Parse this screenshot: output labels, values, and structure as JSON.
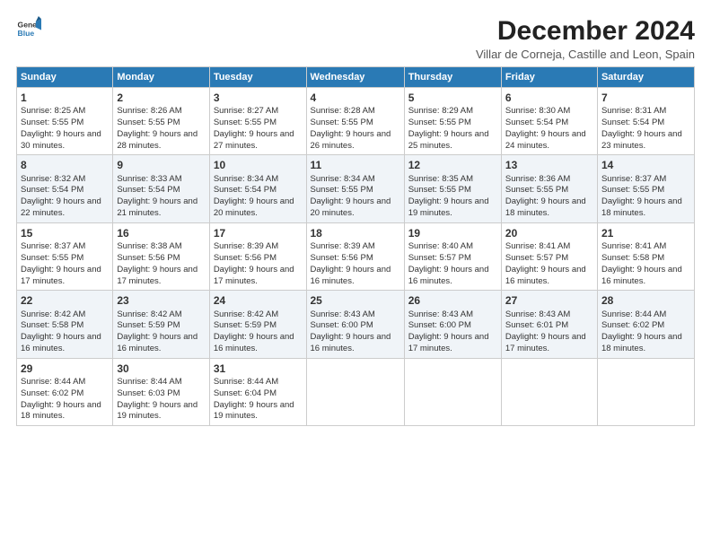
{
  "logo": {
    "line1": "General",
    "line2": "Blue"
  },
  "title": "December 2024",
  "subtitle": "Villar de Corneja, Castille and Leon, Spain",
  "headers": [
    "Sunday",
    "Monday",
    "Tuesday",
    "Wednesday",
    "Thursday",
    "Friday",
    "Saturday"
  ],
  "weeks": [
    [
      {
        "day": "1",
        "text": "Sunrise: 8:25 AM\nSunset: 5:55 PM\nDaylight: 9 hours and 30 minutes."
      },
      {
        "day": "2",
        "text": "Sunrise: 8:26 AM\nSunset: 5:55 PM\nDaylight: 9 hours and 28 minutes."
      },
      {
        "day": "3",
        "text": "Sunrise: 8:27 AM\nSunset: 5:55 PM\nDaylight: 9 hours and 27 minutes."
      },
      {
        "day": "4",
        "text": "Sunrise: 8:28 AM\nSunset: 5:55 PM\nDaylight: 9 hours and 26 minutes."
      },
      {
        "day": "5",
        "text": "Sunrise: 8:29 AM\nSunset: 5:55 PM\nDaylight: 9 hours and 25 minutes."
      },
      {
        "day": "6",
        "text": "Sunrise: 8:30 AM\nSunset: 5:54 PM\nDaylight: 9 hours and 24 minutes."
      },
      {
        "day": "7",
        "text": "Sunrise: 8:31 AM\nSunset: 5:54 PM\nDaylight: 9 hours and 23 minutes."
      }
    ],
    [
      {
        "day": "8",
        "text": "Sunrise: 8:32 AM\nSunset: 5:54 PM\nDaylight: 9 hours and 22 minutes."
      },
      {
        "day": "9",
        "text": "Sunrise: 8:33 AM\nSunset: 5:54 PM\nDaylight: 9 hours and 21 minutes."
      },
      {
        "day": "10",
        "text": "Sunrise: 8:34 AM\nSunset: 5:54 PM\nDaylight: 9 hours and 20 minutes."
      },
      {
        "day": "11",
        "text": "Sunrise: 8:34 AM\nSunset: 5:55 PM\nDaylight: 9 hours and 20 minutes."
      },
      {
        "day": "12",
        "text": "Sunrise: 8:35 AM\nSunset: 5:55 PM\nDaylight: 9 hours and 19 minutes."
      },
      {
        "day": "13",
        "text": "Sunrise: 8:36 AM\nSunset: 5:55 PM\nDaylight: 9 hours and 18 minutes."
      },
      {
        "day": "14",
        "text": "Sunrise: 8:37 AM\nSunset: 5:55 PM\nDaylight: 9 hours and 18 minutes."
      }
    ],
    [
      {
        "day": "15",
        "text": "Sunrise: 8:37 AM\nSunset: 5:55 PM\nDaylight: 9 hours and 17 minutes."
      },
      {
        "day": "16",
        "text": "Sunrise: 8:38 AM\nSunset: 5:56 PM\nDaylight: 9 hours and 17 minutes."
      },
      {
        "day": "17",
        "text": "Sunrise: 8:39 AM\nSunset: 5:56 PM\nDaylight: 9 hours and 17 minutes."
      },
      {
        "day": "18",
        "text": "Sunrise: 8:39 AM\nSunset: 5:56 PM\nDaylight: 9 hours and 16 minutes."
      },
      {
        "day": "19",
        "text": "Sunrise: 8:40 AM\nSunset: 5:57 PM\nDaylight: 9 hours and 16 minutes."
      },
      {
        "day": "20",
        "text": "Sunrise: 8:41 AM\nSunset: 5:57 PM\nDaylight: 9 hours and 16 minutes."
      },
      {
        "day": "21",
        "text": "Sunrise: 8:41 AM\nSunset: 5:58 PM\nDaylight: 9 hours and 16 minutes."
      }
    ],
    [
      {
        "day": "22",
        "text": "Sunrise: 8:42 AM\nSunset: 5:58 PM\nDaylight: 9 hours and 16 minutes."
      },
      {
        "day": "23",
        "text": "Sunrise: 8:42 AM\nSunset: 5:59 PM\nDaylight: 9 hours and 16 minutes."
      },
      {
        "day": "24",
        "text": "Sunrise: 8:42 AM\nSunset: 5:59 PM\nDaylight: 9 hours and 16 minutes."
      },
      {
        "day": "25",
        "text": "Sunrise: 8:43 AM\nSunset: 6:00 PM\nDaylight: 9 hours and 16 minutes."
      },
      {
        "day": "26",
        "text": "Sunrise: 8:43 AM\nSunset: 6:00 PM\nDaylight: 9 hours and 17 minutes."
      },
      {
        "day": "27",
        "text": "Sunrise: 8:43 AM\nSunset: 6:01 PM\nDaylight: 9 hours and 17 minutes."
      },
      {
        "day": "28",
        "text": "Sunrise: 8:44 AM\nSunset: 6:02 PM\nDaylight: 9 hours and 18 minutes."
      }
    ],
    [
      {
        "day": "29",
        "text": "Sunrise: 8:44 AM\nSunset: 6:02 PM\nDaylight: 9 hours and 18 minutes."
      },
      {
        "day": "30",
        "text": "Sunrise: 8:44 AM\nSunset: 6:03 PM\nDaylight: 9 hours and 19 minutes."
      },
      {
        "day": "31",
        "text": "Sunrise: 8:44 AM\nSunset: 6:04 PM\nDaylight: 9 hours and 19 minutes."
      },
      null,
      null,
      null,
      null
    ]
  ]
}
